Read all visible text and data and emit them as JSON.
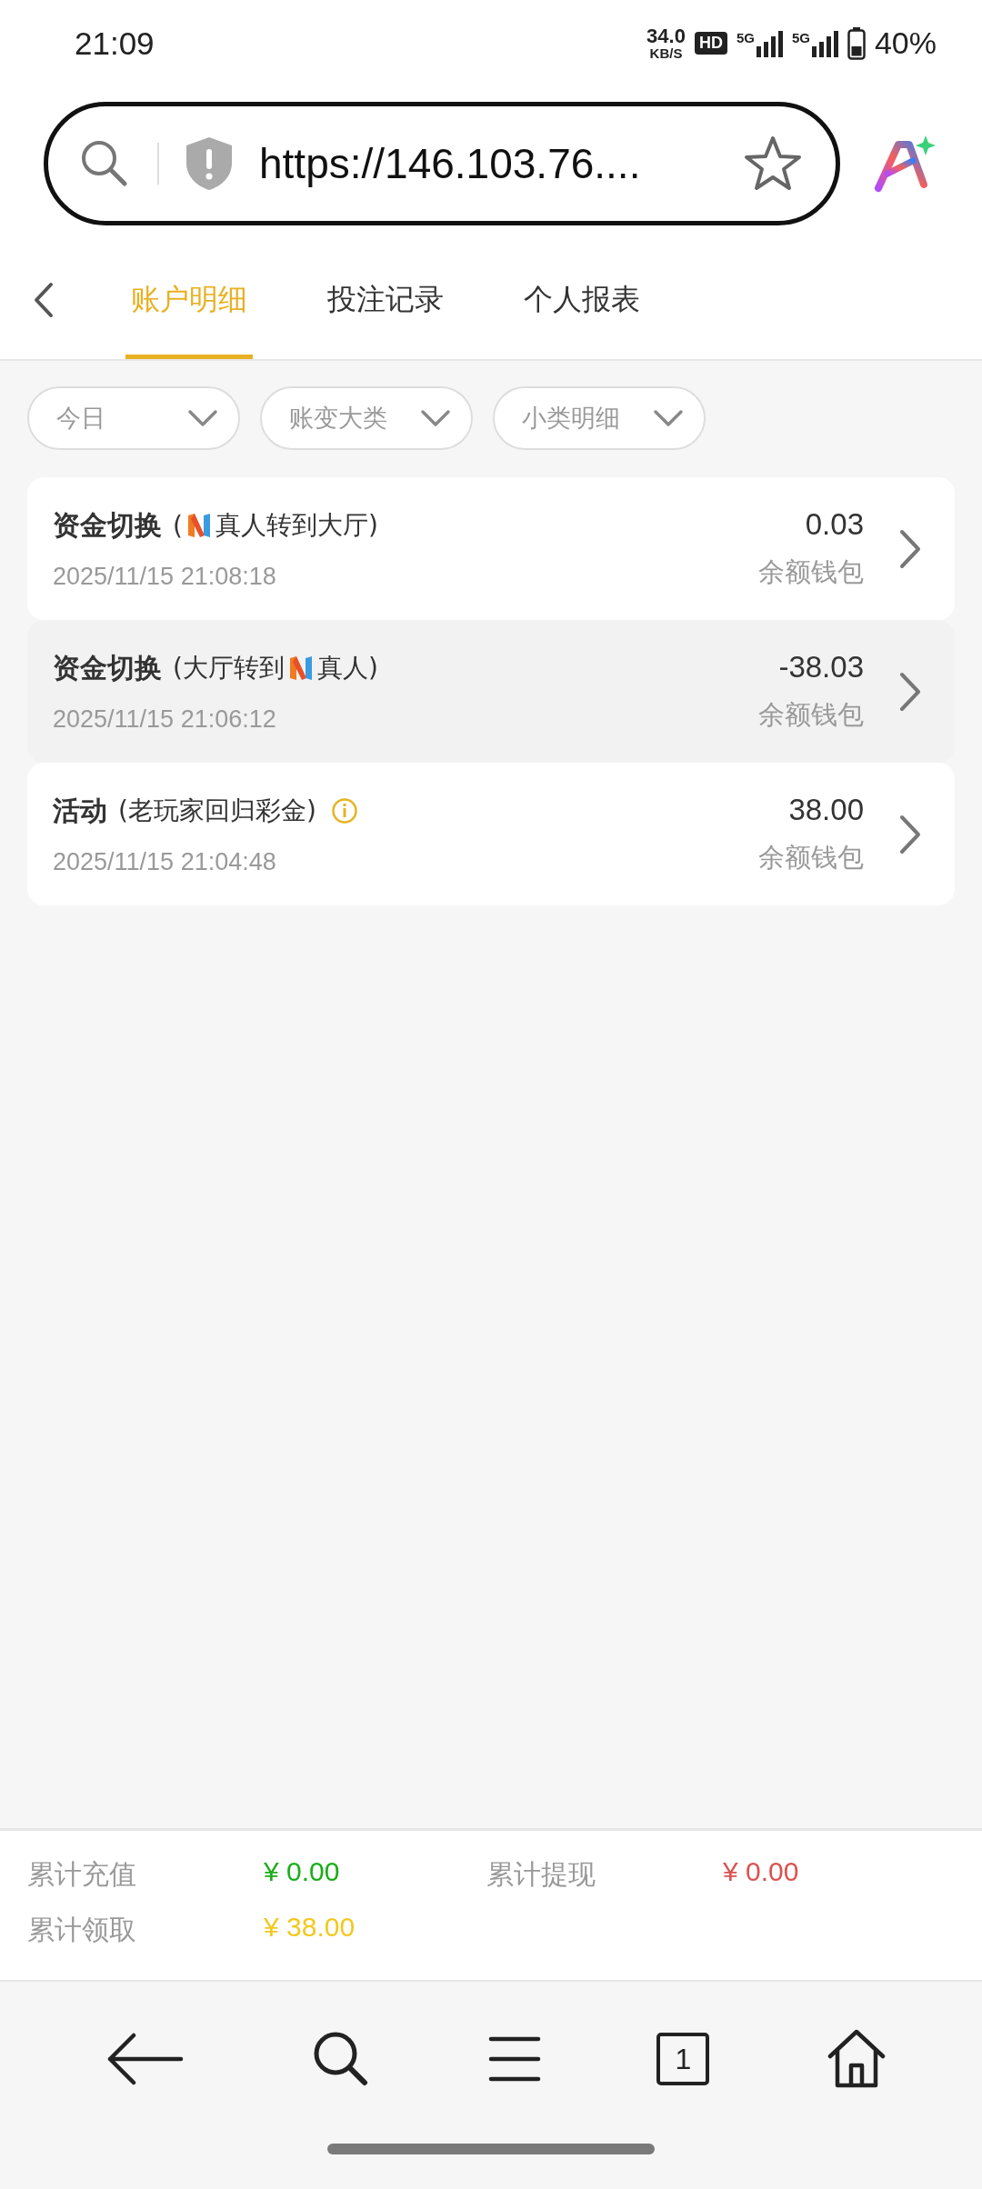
{
  "status_bar": {
    "time": "21:09",
    "speed": "34.0",
    "speed_unit": "KB/S",
    "hd": "HD",
    "networks": [
      "5G",
      "5G"
    ],
    "battery": "40%"
  },
  "browser": {
    "url": "https://146.103.76...."
  },
  "tabs": [
    {
      "label": "账户明细",
      "selected": true
    },
    {
      "label": "投注记录",
      "selected": false
    },
    {
      "label": "个人报表",
      "selected": false
    }
  ],
  "filters": [
    {
      "label": "今日"
    },
    {
      "label": "账变大类"
    },
    {
      "label": "小类明细"
    }
  ],
  "records": [
    {
      "title": "资金切换",
      "detail": [
        {
          "kind": "text",
          "text": "("
        },
        {
          "kind": "logo"
        },
        {
          "kind": "text",
          "text": "真人转到大厅)"
        }
      ],
      "time": "2025/11/15 21:08:18",
      "amount": "0.03",
      "wallet": "余额钱包",
      "shaded": false
    },
    {
      "title": "资金切换",
      "detail": [
        {
          "kind": "text",
          "text": "(大厅转到"
        },
        {
          "kind": "logo"
        },
        {
          "kind": "text",
          "text": "真人)"
        }
      ],
      "time": "2025/11/15 21:06:12",
      "amount": "-38.03",
      "wallet": "余额钱包",
      "shaded": true
    },
    {
      "title": "活动",
      "detail": [
        {
          "kind": "text",
          "text": "(老玩家回归彩金)"
        },
        {
          "kind": "info"
        }
      ],
      "time": "2025/11/15 21:04:48",
      "amount": "38.00",
      "wallet": "余额钱包",
      "shaded": false
    }
  ],
  "summary": [
    {
      "label": "累计充值",
      "value": "¥ 0.00",
      "color": "#1aad19"
    },
    {
      "label": "累计提现",
      "value": "¥ 0.00",
      "color": "#d9534f"
    },
    {
      "label": "累计领取",
      "value": "¥ 38.00",
      "color": "#f2c81e"
    }
  ],
  "bottom_nav": {
    "tab_count": "1"
  }
}
